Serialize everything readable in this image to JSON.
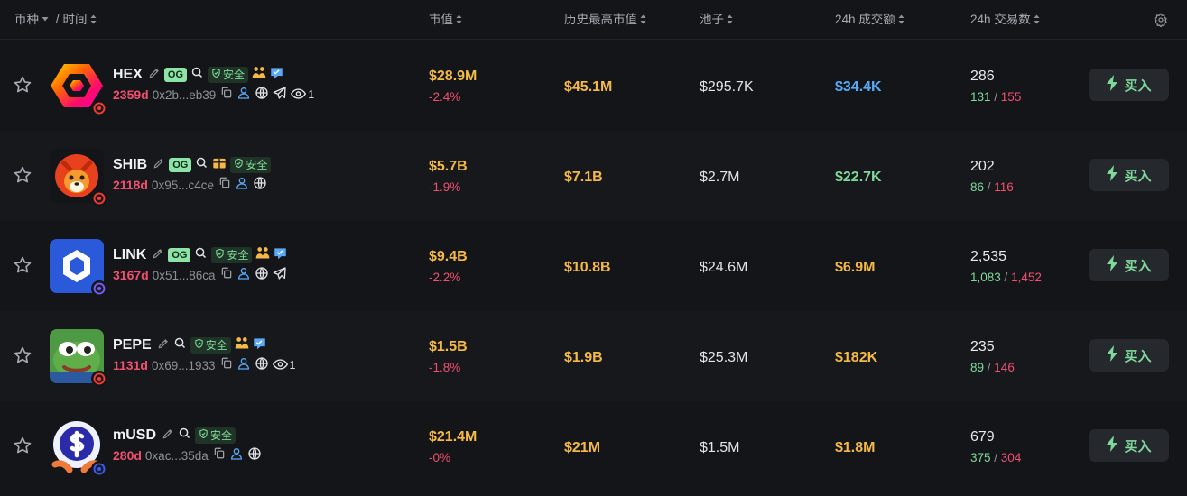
{
  "header": {
    "coin": "币种",
    "sep": "/",
    "time": "时间",
    "market_cap": "市值",
    "ath_market_cap": "历史最高市值",
    "pool": "池子",
    "volume_24h": "24h 成交额",
    "txns_24h": "24h 交易数"
  },
  "labels": {
    "og": "OG",
    "safe": "安全",
    "buy": "买入"
  },
  "colors": {
    "accent_green": "#7fd99a",
    "red": "#f0506e",
    "gold": "#f5b945",
    "blue": "#5aa9f7"
  },
  "tokens": [
    {
      "symbol": "HEX",
      "age": "2359d",
      "address": "0x2b...eb39",
      "og": true,
      "has_views": true,
      "views": "1",
      "market_cap": "$28.9M",
      "change": "-2.4%",
      "ath": "$45.1M",
      "pool": "$295.7K",
      "volume": "$34.4K",
      "volume_color": "#5aa9f7",
      "txns": "286",
      "buys": "131",
      "sells": "155",
      "icons": [
        "holders-icon",
        "verified-icon"
      ],
      "socials": [
        "user-icon",
        "globe-icon",
        "telegram-icon"
      ]
    },
    {
      "symbol": "SHIB",
      "age": "2118d",
      "address": "0x95...c4ce",
      "og": true,
      "has_views": false,
      "market_cap": "$5.7B",
      "change": "-1.9%",
      "ath": "$7.1B",
      "pool": "$2.7M",
      "volume": "$22.7K",
      "volume_color": "#7fd99a",
      "txns": "202",
      "buys": "86",
      "sells": "116",
      "icons": [
        "box-icon"
      ],
      "socials": [
        "user-icon",
        "globe-icon"
      ]
    },
    {
      "symbol": "LINK",
      "age": "3167d",
      "address": "0x51...86ca",
      "og": true,
      "has_views": false,
      "market_cap": "$9.4B",
      "change": "-2.2%",
      "ath": "$10.8B",
      "pool": "$24.6M",
      "volume": "$6.9M",
      "volume_color": "#f5b945",
      "txns": "2,535",
      "buys": "1,083",
      "sells": "1,452",
      "icons": [
        "holders-icon",
        "verified-icon"
      ],
      "socials": [
        "user-icon",
        "globe-icon",
        "telegram-icon"
      ]
    },
    {
      "symbol": "PEPE",
      "age": "1131d",
      "address": "0x69...1933",
      "og": false,
      "has_views": true,
      "views": "1",
      "market_cap": "$1.5B",
      "change": "-1.8%",
      "ath": "$1.9B",
      "pool": "$25.3M",
      "volume": "$182K",
      "volume_color": "#f5b945",
      "txns": "235",
      "buys": "89",
      "sells": "146",
      "icons": [
        "holders-icon",
        "verified-icon"
      ],
      "socials": [
        "user-icon",
        "globe-icon"
      ]
    },
    {
      "symbol": "mUSD",
      "age": "280d",
      "address": "0xac...35da",
      "og": false,
      "has_views": false,
      "market_cap": "$21.4M",
      "change": "-0%",
      "ath": "$21M",
      "pool": "$1.5M",
      "volume": "$1.8M",
      "volume_color": "#f5b945",
      "txns": "679",
      "buys": "375",
      "sells": "304",
      "icons": [],
      "socials": [
        "user-icon",
        "globe-icon"
      ]
    }
  ]
}
